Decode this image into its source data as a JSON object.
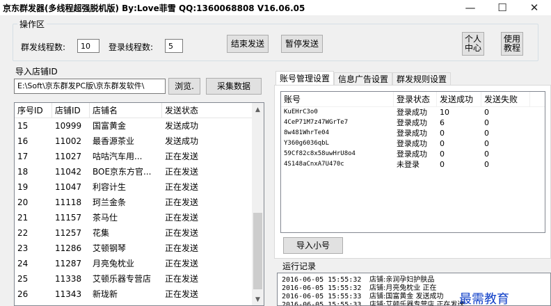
{
  "window": {
    "title": "京东群发器(多线程超强脱机版) By:Love菲雪 QQ:1360068808  V16.06.05",
    "min_symbol": "—",
    "max_symbol": "☐",
    "close_symbol": "✕"
  },
  "operation": {
    "group_title": "操作区",
    "send_threads_label": "群发线程数:",
    "send_threads_value": "10",
    "login_threads_label": "登录线程数:",
    "login_threads_value": "5",
    "stop_button": "结束发送",
    "pause_button": "暂停发送",
    "personal_center_button": "个人\n中心",
    "tutorial_button": "使用\n教程"
  },
  "import": {
    "label": "导入店铺ID",
    "path_value": "E:\\Soft\\京东群发PC版\\京东群发软件\\",
    "browse_button": "浏览.",
    "collect_button": "采集数据"
  },
  "shop_table": {
    "columns": [
      "序号ID",
      "店铺ID",
      "店铺名",
      "发送状态"
    ],
    "rows": [
      [
        "15",
        "10999",
        "国富黄金",
        "发送成功"
      ],
      [
        "16",
        "11002",
        "最香源茶业",
        "发送成功"
      ],
      [
        "17",
        "11027",
        "咕咕汽车用...",
        "正在发送"
      ],
      [
        "18",
        "11042",
        "BOE京东方官...",
        "正在发送"
      ],
      [
        "19",
        "11047",
        "利容计生",
        "正在发送"
      ],
      [
        "20",
        "11118",
        "珂兰金条",
        "正在发送"
      ],
      [
        "21",
        "11157",
        "茶马仕",
        "正在发送"
      ],
      [
        "22",
        "11257",
        "花集",
        "正在发送"
      ],
      [
        "23",
        "11286",
        "艾顿钢琴",
        "正在发送"
      ],
      [
        "24",
        "11287",
        "月亮兔枕业",
        "正在发送"
      ],
      [
        "25",
        "11338",
        "艾顿乐器专营店",
        "正在发送"
      ],
      [
        "26",
        "11343",
        "新珑新",
        "正在发送"
      ]
    ],
    "scroll_up": "▲",
    "scroll_down": "▼"
  },
  "tabs": {
    "items": [
      "账号管理设置",
      "信息广告设置",
      "群发规则设置"
    ],
    "active_index": 0
  },
  "account_table": {
    "columns": [
      "账号",
      "登录状态",
      "发送成功",
      "发送失败"
    ],
    "rows": [
      [
        "KuEHrC3o0",
        "登录成功",
        "10",
        "0"
      ],
      [
        "4CeP71M7z47WGrTe7",
        "登录成功",
        "6",
        "0"
      ],
      [
        "8w481WhrTe04",
        "登录成功",
        "0",
        "0"
      ],
      [
        "Y360g6036qbL",
        "登录成功",
        "0",
        "0"
      ],
      [
        "59Cf82c8x58uwHrU8o4",
        "登录成功",
        "0",
        "0"
      ],
      [
        "4S148aCnxA7U470c",
        "未登录",
        "0",
        "0"
      ]
    ],
    "import_button": "导入小号"
  },
  "log": {
    "label": "运行记录",
    "lines": [
      {
        "ts": "2016-06-05 15:55:32",
        "msg": "店铺:亲润孕妇护肤品"
      },
      {
        "ts": "2016-06-05 15:55:32",
        "msg": "店铺:月亮兔枕业 正在"
      },
      {
        "ts": "2016-06-05 15:55:33",
        "msg": "店铺:国富黄金 发送成功"
      },
      {
        "ts": "2016-06-05 15:55:33",
        "msg": "店铺:艾顿乐器专营店 正在发送"
      }
    ]
  },
  "watermark": "最需教育"
}
